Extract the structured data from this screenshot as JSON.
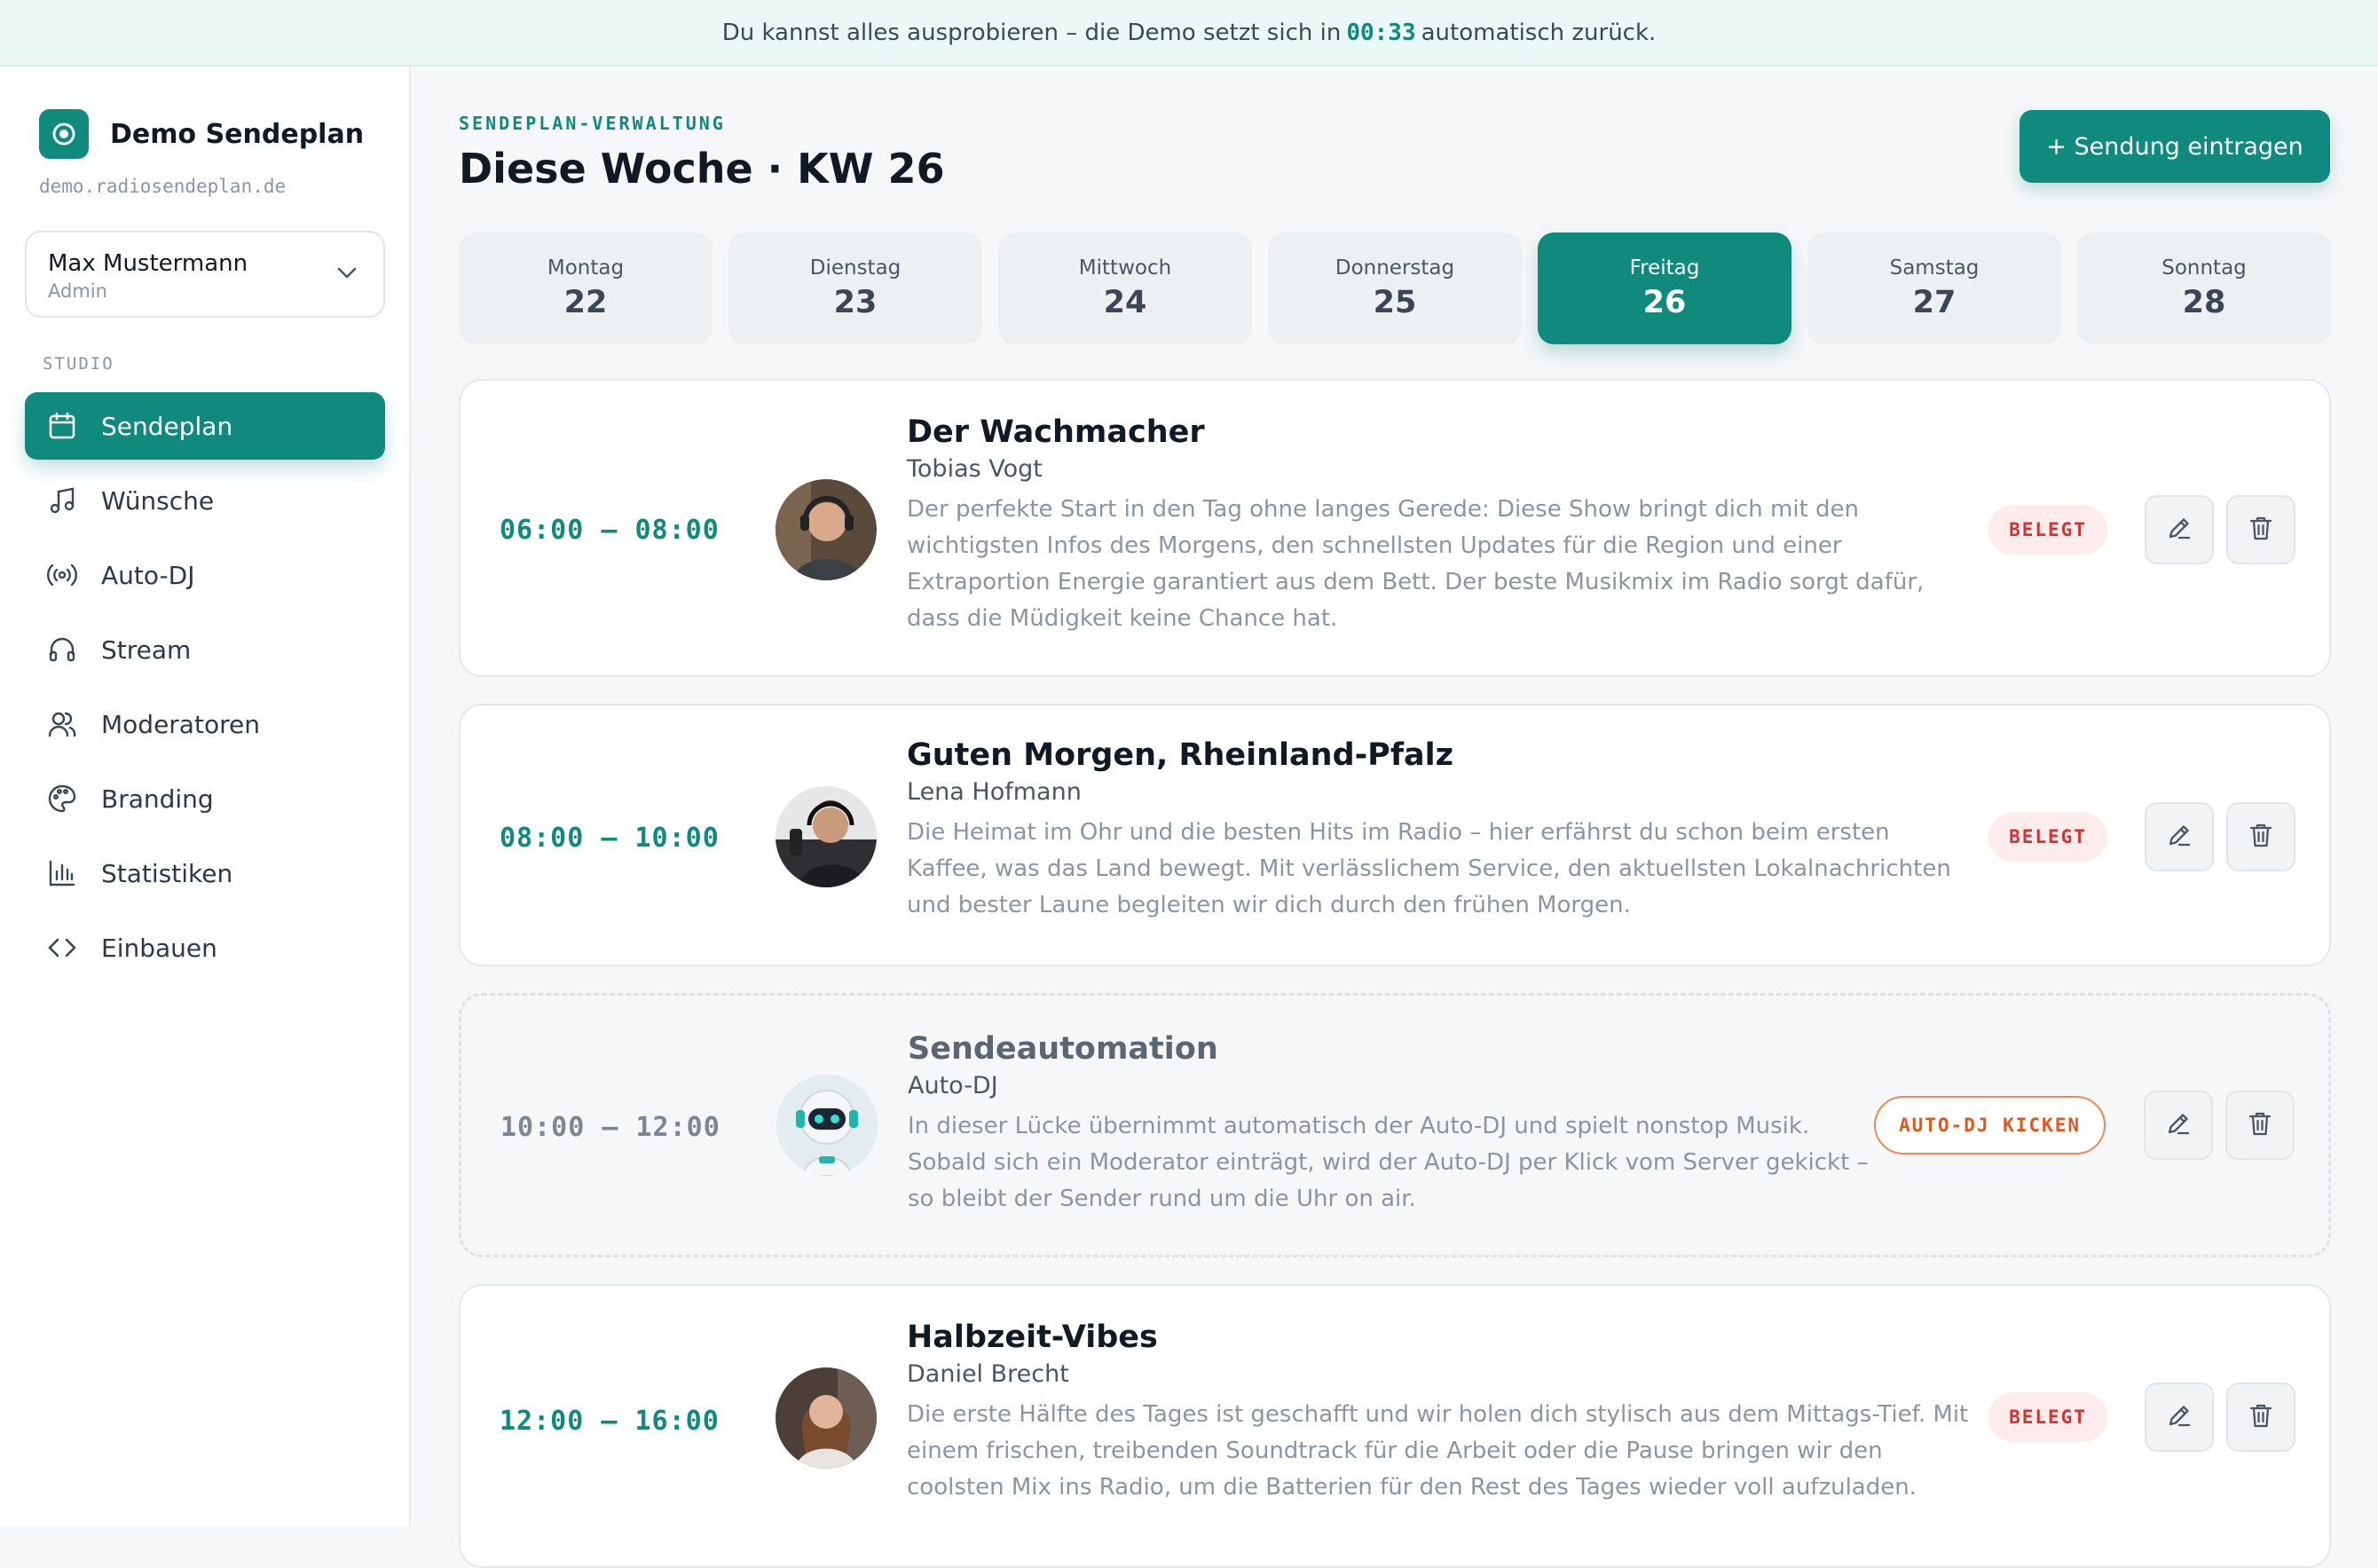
{
  "banner": {
    "text_before": "Du kannst alles ausprobieren – die Demo setzt sich in",
    "countdown": "00:33",
    "text_after": "automatisch zurück."
  },
  "sidebar": {
    "brand_title": "Demo Sendeplan",
    "brand_domain": "demo.radiosendeplan.de",
    "user": {
      "name": "Max Mustermann",
      "role": "Admin"
    },
    "section_label": "STUDIO",
    "items": [
      {
        "label": "Sendeplan",
        "icon": "calendar-icon",
        "active": true
      },
      {
        "label": "Wünsche",
        "icon": "music-note-icon",
        "active": false
      },
      {
        "label": "Auto-DJ",
        "icon": "broadcast-icon",
        "active": false
      },
      {
        "label": "Stream",
        "icon": "headphones-icon",
        "active": false
      },
      {
        "label": "Moderatoren",
        "icon": "users-icon",
        "active": false
      },
      {
        "label": "Branding",
        "icon": "palette-icon",
        "active": false
      },
      {
        "label": "Statistiken",
        "icon": "bar-chart-icon",
        "active": false
      },
      {
        "label": "Einbauen",
        "icon": "code-icon",
        "active": false
      }
    ]
  },
  "header": {
    "eyebrow": "SENDEPLAN-VERWALTUNG",
    "title": "Diese Woche · KW 26",
    "add_button": "+ Sendung eintragen"
  },
  "days": [
    {
      "name": "Montag",
      "num": "22",
      "active": false
    },
    {
      "name": "Dienstag",
      "num": "23",
      "active": false
    },
    {
      "name": "Mittwoch",
      "num": "24",
      "active": false
    },
    {
      "name": "Donnerstag",
      "num": "25",
      "active": false
    },
    {
      "name": "Freitag",
      "num": "26",
      "active": true
    },
    {
      "name": "Samstag",
      "num": "27",
      "active": false
    },
    {
      "name": "Sonntag",
      "num": "28",
      "active": false
    }
  ],
  "shows": [
    {
      "time": "06:00 – 08:00",
      "title": "Der Wachmacher",
      "host": "Tobias Vogt",
      "description": "Der perfekte Start in den Tag ohne langes Gerede: Diese Show bringt dich mit den wichtigsten Infos des Morgens, den schnellsten Updates für die Region und einer Extraportion Energie garantiert aus dem Bett. Der beste Musikmix im Radio sorgt dafür, dass die Müdigkeit keine Chance hat.",
      "badge": "BELEGT"
    },
    {
      "time": "08:00 – 10:00",
      "title": "Guten Morgen, Rheinland-Pfalz",
      "host": "Lena Hofmann",
      "description": "Die Heimat im Ohr und die besten Hits im Radio – hier erfährst du schon beim ersten Kaffee, was das Land bewegt. Mit verlässlichem Service, den aktuellsten Lokalnachrichten und bester Laune begleiten wir dich durch den frühen Morgen.",
      "badge": "BELEGT"
    },
    {
      "time": "10:00 – 12:00",
      "title": "Sendeautomation",
      "host": "Auto-DJ",
      "description": "In dieser Lücke übernimmt automatisch der Auto-DJ und spielt nonstop Musik. Sobald sich ein Moderator einträgt, wird der Auto-DJ per Klick vom Server gekickt – so bleibt der Sender rund um die Uhr on air.",
      "badge": "AUTO-DJ KICKEN"
    },
    {
      "time": "12:00 – 16:00",
      "title": "Halbzeit-Vibes",
      "host": "Daniel Brecht",
      "description": "Die erste Hälfte des Tages ist geschafft und wir holen dich stylisch aus dem Mittags-Tief. Mit einem frischen, treibenden Soundtrack für die Arbeit oder die Pause bringen wir den coolsten Mix ins Radio, um die Batterien für den Rest des Tages wieder voll aufzuladen.",
      "badge": "BELEGT"
    }
  ],
  "colors": {
    "accent": "#0f8a7c",
    "busy": "#d03535",
    "kick": "#e2581c"
  }
}
